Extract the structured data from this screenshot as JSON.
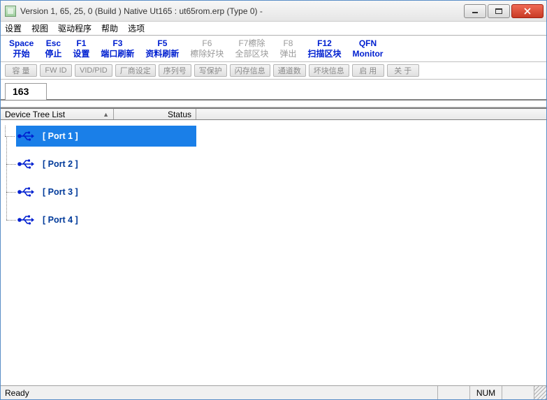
{
  "title": "Version 1, 65, 25, 0 (Build )  Native Ut165 : ut65rom.erp  (Type 0)  -",
  "menu": {
    "items": [
      "设置",
      "视图",
      "驱动程序",
      "帮助",
      "选项"
    ]
  },
  "fnkeys": [
    {
      "key": "Space",
      "label": "开始",
      "enabled": true
    },
    {
      "key": "Esc",
      "label": "停止",
      "enabled": true
    },
    {
      "key": "F1",
      "label": "设置",
      "enabled": true
    },
    {
      "key": "F3",
      "label": "端口刷新",
      "enabled": true
    },
    {
      "key": "F5",
      "label": "资料刷新",
      "enabled": true
    },
    {
      "key": "F6",
      "label": "檫除好块",
      "enabled": false
    },
    {
      "key": "F7檫除",
      "label": "全部区块",
      "enabled": false
    },
    {
      "key": "F8",
      "label": "弹出",
      "enabled": false
    },
    {
      "key": "F12",
      "label": "扫描区块",
      "enabled": true
    },
    {
      "key": "QFN",
      "label": "Monitor",
      "enabled": true
    }
  ],
  "graybuttons": [
    "容  量",
    "FW ID",
    "VID/PID",
    "厂商设定",
    "序列号",
    "写保护",
    "闪存信息",
    "通道数",
    "坏块信息",
    "启  用",
    "关  于"
  ],
  "tab_label": "163",
  "columns": {
    "c1": "Device Tree List",
    "c2": "Status"
  },
  "ports": [
    {
      "label": "[ Port  1 ]",
      "selected": true
    },
    {
      "label": "[ Port  2 ]",
      "selected": false
    },
    {
      "label": "[ Port  3 ]",
      "selected": false
    },
    {
      "label": "[ Port  4 ]",
      "selected": false
    }
  ],
  "status": {
    "left": "Ready",
    "indicator": "NUM"
  }
}
